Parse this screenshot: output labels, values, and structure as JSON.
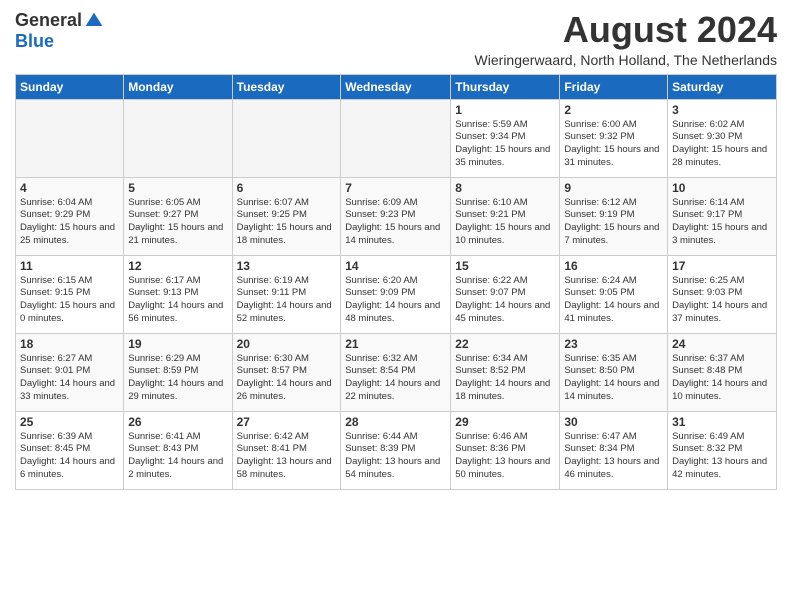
{
  "header": {
    "logo_general": "General",
    "logo_blue": "Blue",
    "main_title": "August 2024",
    "subtitle": "Wieringerwaard, North Holland, The Netherlands"
  },
  "days_of_week": [
    "Sunday",
    "Monday",
    "Tuesday",
    "Wednesday",
    "Thursday",
    "Friday",
    "Saturday"
  ],
  "weeks": [
    [
      {
        "day": "",
        "info": ""
      },
      {
        "day": "",
        "info": ""
      },
      {
        "day": "",
        "info": ""
      },
      {
        "day": "",
        "info": ""
      },
      {
        "day": "1",
        "info": "Sunrise: 5:59 AM\nSunset: 9:34 PM\nDaylight: 15 hours and 35 minutes."
      },
      {
        "day": "2",
        "info": "Sunrise: 6:00 AM\nSunset: 9:32 PM\nDaylight: 15 hours and 31 minutes."
      },
      {
        "day": "3",
        "info": "Sunrise: 6:02 AM\nSunset: 9:30 PM\nDaylight: 15 hours and 28 minutes."
      }
    ],
    [
      {
        "day": "4",
        "info": "Sunrise: 6:04 AM\nSunset: 9:29 PM\nDaylight: 15 hours and 25 minutes."
      },
      {
        "day": "5",
        "info": "Sunrise: 6:05 AM\nSunset: 9:27 PM\nDaylight: 15 hours and 21 minutes."
      },
      {
        "day": "6",
        "info": "Sunrise: 6:07 AM\nSunset: 9:25 PM\nDaylight: 15 hours and 18 minutes."
      },
      {
        "day": "7",
        "info": "Sunrise: 6:09 AM\nSunset: 9:23 PM\nDaylight: 15 hours and 14 minutes."
      },
      {
        "day": "8",
        "info": "Sunrise: 6:10 AM\nSunset: 9:21 PM\nDaylight: 15 hours and 10 minutes."
      },
      {
        "day": "9",
        "info": "Sunrise: 6:12 AM\nSunset: 9:19 PM\nDaylight: 15 hours and 7 minutes."
      },
      {
        "day": "10",
        "info": "Sunrise: 6:14 AM\nSunset: 9:17 PM\nDaylight: 15 hours and 3 minutes."
      }
    ],
    [
      {
        "day": "11",
        "info": "Sunrise: 6:15 AM\nSunset: 9:15 PM\nDaylight: 15 hours and 0 minutes."
      },
      {
        "day": "12",
        "info": "Sunrise: 6:17 AM\nSunset: 9:13 PM\nDaylight: 14 hours and 56 minutes."
      },
      {
        "day": "13",
        "info": "Sunrise: 6:19 AM\nSunset: 9:11 PM\nDaylight: 14 hours and 52 minutes."
      },
      {
        "day": "14",
        "info": "Sunrise: 6:20 AM\nSunset: 9:09 PM\nDaylight: 14 hours and 48 minutes."
      },
      {
        "day": "15",
        "info": "Sunrise: 6:22 AM\nSunset: 9:07 PM\nDaylight: 14 hours and 45 minutes."
      },
      {
        "day": "16",
        "info": "Sunrise: 6:24 AM\nSunset: 9:05 PM\nDaylight: 14 hours and 41 minutes."
      },
      {
        "day": "17",
        "info": "Sunrise: 6:25 AM\nSunset: 9:03 PM\nDaylight: 14 hours and 37 minutes."
      }
    ],
    [
      {
        "day": "18",
        "info": "Sunrise: 6:27 AM\nSunset: 9:01 PM\nDaylight: 14 hours and 33 minutes."
      },
      {
        "day": "19",
        "info": "Sunrise: 6:29 AM\nSunset: 8:59 PM\nDaylight: 14 hours and 29 minutes."
      },
      {
        "day": "20",
        "info": "Sunrise: 6:30 AM\nSunset: 8:57 PM\nDaylight: 14 hours and 26 minutes."
      },
      {
        "day": "21",
        "info": "Sunrise: 6:32 AM\nSunset: 8:54 PM\nDaylight: 14 hours and 22 minutes."
      },
      {
        "day": "22",
        "info": "Sunrise: 6:34 AM\nSunset: 8:52 PM\nDaylight: 14 hours and 18 minutes."
      },
      {
        "day": "23",
        "info": "Sunrise: 6:35 AM\nSunset: 8:50 PM\nDaylight: 14 hours and 14 minutes."
      },
      {
        "day": "24",
        "info": "Sunrise: 6:37 AM\nSunset: 8:48 PM\nDaylight: 14 hours and 10 minutes."
      }
    ],
    [
      {
        "day": "25",
        "info": "Sunrise: 6:39 AM\nSunset: 8:45 PM\nDaylight: 14 hours and 6 minutes."
      },
      {
        "day": "26",
        "info": "Sunrise: 6:41 AM\nSunset: 8:43 PM\nDaylight: 14 hours and 2 minutes."
      },
      {
        "day": "27",
        "info": "Sunrise: 6:42 AM\nSunset: 8:41 PM\nDaylight: 13 hours and 58 minutes."
      },
      {
        "day": "28",
        "info": "Sunrise: 6:44 AM\nSunset: 8:39 PM\nDaylight: 13 hours and 54 minutes."
      },
      {
        "day": "29",
        "info": "Sunrise: 6:46 AM\nSunset: 8:36 PM\nDaylight: 13 hours and 50 minutes."
      },
      {
        "day": "30",
        "info": "Sunrise: 6:47 AM\nSunset: 8:34 PM\nDaylight: 13 hours and 46 minutes."
      },
      {
        "day": "31",
        "info": "Sunrise: 6:49 AM\nSunset: 8:32 PM\nDaylight: 13 hours and 42 minutes."
      }
    ]
  ]
}
